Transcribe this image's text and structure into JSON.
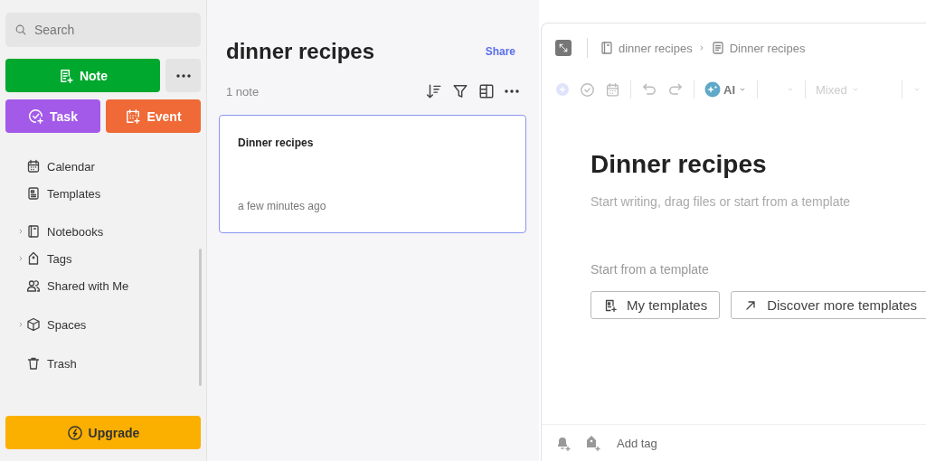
{
  "sidebar": {
    "search": {
      "placeholder": "Search"
    },
    "create_buttons": [
      {
        "label": "Note",
        "kind": "note"
      },
      {
        "label": "Task",
        "kind": "task"
      },
      {
        "label": "Event",
        "kind": "event"
      }
    ],
    "items": [
      {
        "label": "Calendar",
        "kind": "calendar"
      },
      {
        "label": "Templates",
        "kind": "templates"
      },
      {
        "label": "Notebooks",
        "kind": "notebooks",
        "expanded": false
      },
      {
        "label": "Tags",
        "kind": "tags",
        "expanded": false
      },
      {
        "label": "Shared with Me",
        "kind": "shared"
      },
      {
        "label": "Spaces",
        "kind": "spaces",
        "expanded": false
      },
      {
        "label": "Trash",
        "kind": "trash"
      }
    ],
    "upgrade": {
      "label": "Upgrade"
    }
  },
  "note_list": {
    "title": "dinner recipes",
    "share": "Share",
    "count": "1 note",
    "notes": [
      {
        "title": "Dinner recipes",
        "time": "a few minutes ago",
        "selected": true
      }
    ]
  },
  "editor": {
    "breadcrumb": [
      "dinner recipes",
      "Dinner recipes"
    ],
    "toolbar": {
      "ai": "AI",
      "style": "Mixed"
    },
    "title": "Dinner recipes",
    "placeholder": "Start writing, drag files or start from a template",
    "template_heading": "Start from a template",
    "template_buttons": [
      {
        "label": "My templates",
        "kind": "mine"
      },
      {
        "label": "Discover more templates",
        "kind": "discover"
      }
    ],
    "footer": {
      "add_tag": "Add tag"
    }
  }
}
